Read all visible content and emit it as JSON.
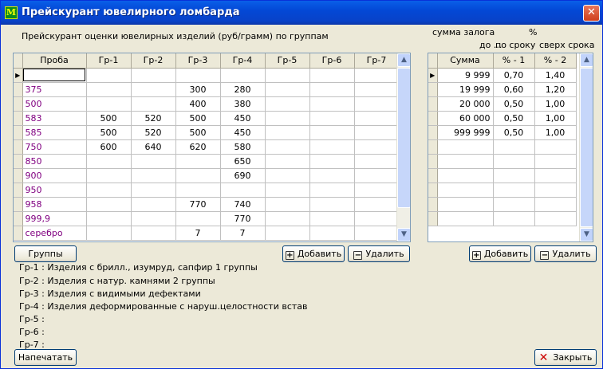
{
  "window": {
    "title": "Прейскурант ювелирного ломбарда",
    "icon_letter": "M"
  },
  "left": {
    "caption": "Прейскурант оценки ювелирных изделий (руб/грамм) по группам",
    "columns": [
      "Проба",
      "Гр-1",
      "Гр-2",
      "Гр-3",
      "Гр-4",
      "Гр-5",
      "Гр-6",
      "Гр-7"
    ],
    "rows": [
      [
        "",
        "",
        "",
        "",
        "",
        "",
        "",
        ""
      ],
      [
        "375",
        "",
        "",
        "300",
        "280",
        "",
        "",
        ""
      ],
      [
        "500",
        "",
        "",
        "400",
        "380",
        "",
        "",
        ""
      ],
      [
        "583",
        "500",
        "520",
        "500",
        "450",
        "",
        "",
        ""
      ],
      [
        "585",
        "500",
        "520",
        "500",
        "450",
        "",
        "",
        ""
      ],
      [
        "750",
        "600",
        "640",
        "620",
        "580",
        "",
        "",
        ""
      ],
      [
        "850",
        "",
        "",
        "",
        "650",
        "",
        "",
        ""
      ],
      [
        "900",
        "",
        "",
        "",
        "690",
        "",
        "",
        ""
      ],
      [
        "950",
        "",
        "",
        "",
        "",
        "",
        "",
        ""
      ],
      [
        "958",
        "",
        "",
        "770",
        "740",
        "",
        "",
        ""
      ],
      [
        "999,9",
        "",
        "",
        "",
        "770",
        "",
        "",
        ""
      ],
      [
        "серебро",
        "",
        "",
        "7",
        "7",
        "",
        "",
        ""
      ]
    ],
    "groups_button": "Группы",
    "add_button": "Добавить",
    "delete_button": "Удалить"
  },
  "right": {
    "caption_sum": "сумма залога",
    "caption_to": "до ...",
    "caption_pct": "%",
    "caption_term": "по сроку",
    "caption_over": "сверх срока",
    "columns": [
      "Сумма",
      "% - 1",
      "% - 2"
    ],
    "rows": [
      [
        "9 999",
        "0,70",
        "1,40"
      ],
      [
        "19 999",
        "0,60",
        "1,20"
      ],
      [
        "20 000",
        "0,50",
        "1,00"
      ],
      [
        "60 000",
        "0,50",
        "1,00"
      ],
      [
        "999 999",
        "0,50",
        "1,00"
      ]
    ],
    "empty_rows": 6,
    "add_button": "Добавить",
    "delete_button": "Удалить"
  },
  "legend": [
    "Гр-1 : Изделия с брилл., изумруд, сапфир 1 группы",
    "Гр-2 : Изделия с натур. камнями 2 группы",
    "Гр-3 : Изделия с видимыми дефектами",
    "Гр-4 : Изделия деформированные с наруш.целостности встав",
    "Гр-5 :",
    "Гр-6 :",
    "Гр-7 :"
  ],
  "print_button": "Напечатать",
  "close_button": "Закрыть",
  "icons": {
    "plus": "+",
    "minus": "−",
    "row_marker": "▶",
    "close_x": "✕",
    "scroll_up": "▲",
    "scroll_down": "▼",
    "title_close": "✕"
  },
  "colors": {
    "proba_text": "#800080",
    "titlebar": "#0348d6",
    "close_red": "#cc0000"
  }
}
